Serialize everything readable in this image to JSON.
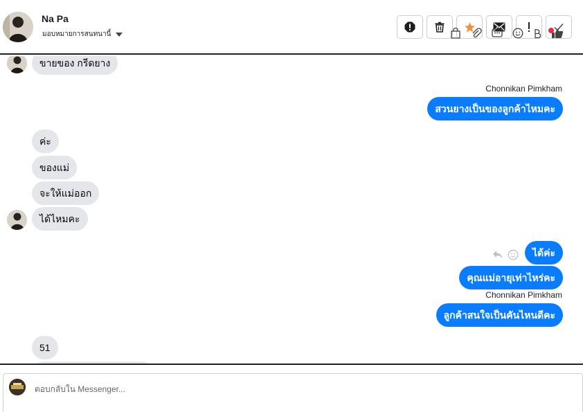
{
  "header": {
    "name": "Na Pa",
    "assign_label": "มอบหมายการสนทนานี้"
  },
  "actions": [
    "spam-icon",
    "trash-icon",
    "star-icon",
    "mail-icon",
    "exclamation-icon",
    "check-icon"
  ],
  "thread": {
    "incoming_top": "ขายของ กรีดยาง",
    "sender_1": "Chonnikan Pimkham",
    "outgoing_1": "สวนยางเป็นของลูกค้าไหมคะ",
    "incoming_1": "ค่ะ",
    "incoming_2": "ของแม่",
    "incoming_3": "จะให้แม่ออก",
    "incoming_4": "ได้ไหมคะ",
    "outgoing_2": "ได้ค่ะ",
    "outgoing_3": "คุณแม่อายุเท่าไหร่คะ",
    "sender_2": "Chonnikan Pimkham",
    "outgoing_4": "ลูกค้าสนใจเป็นคันไหนดีคะ",
    "incoming_5": "51"
  },
  "composer": {
    "placeholder": "ตอบกลับใน Messenger..."
  },
  "colors": {
    "outgoing_bubble": "#0a7cff",
    "incoming_bubble": "#e4e6eb",
    "star": "#f7923a",
    "notification_dot": "#f02849"
  }
}
